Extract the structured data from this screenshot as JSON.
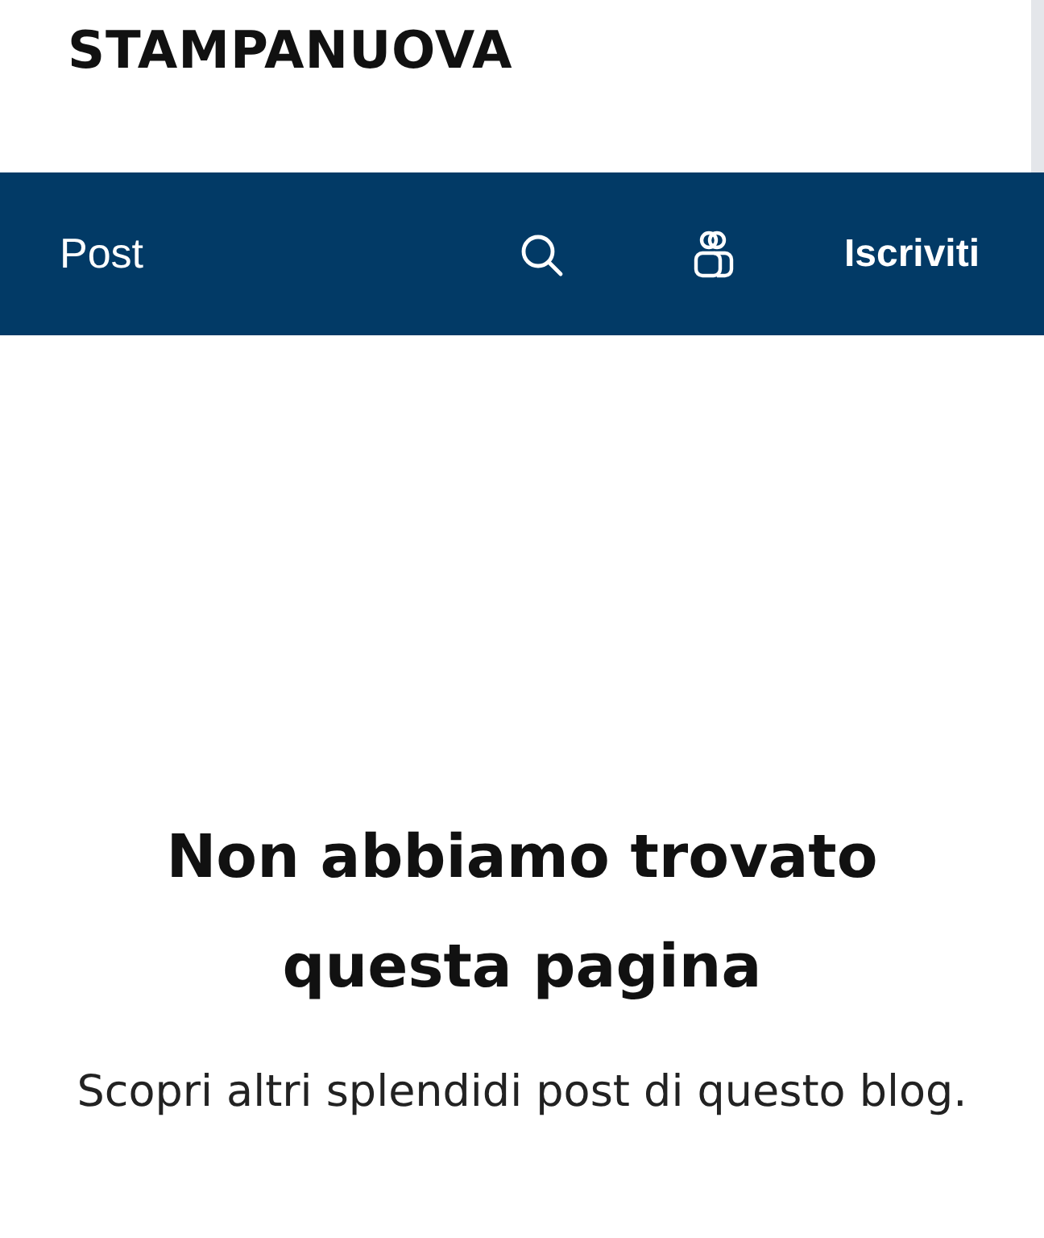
{
  "site_title": "STAMPANUOVA",
  "nav": {
    "link": "Post",
    "subscribe": "Iscriviti"
  },
  "message": {
    "heading": "Non abbiamo trovato questa pagina",
    "text": "Scopri altri splendidi post di questo blog."
  }
}
